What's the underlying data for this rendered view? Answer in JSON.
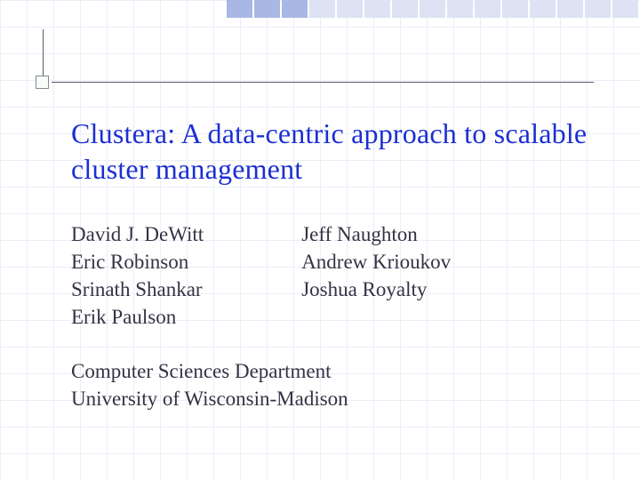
{
  "title": "Clustera:  A data-centric approach to scalable cluster management",
  "authors_col1": [
    "David J. DeWitt",
    "Eric Robinson",
    "Srinath Shankar",
    "Erik Paulson"
  ],
  "authors_col2": [
    "Jeff Naughton",
    "Andrew Krioukov",
    "Joshua Royalty"
  ],
  "affiliation": [
    "Computer Sciences Department",
    "University of Wisconsin-Madison"
  ]
}
